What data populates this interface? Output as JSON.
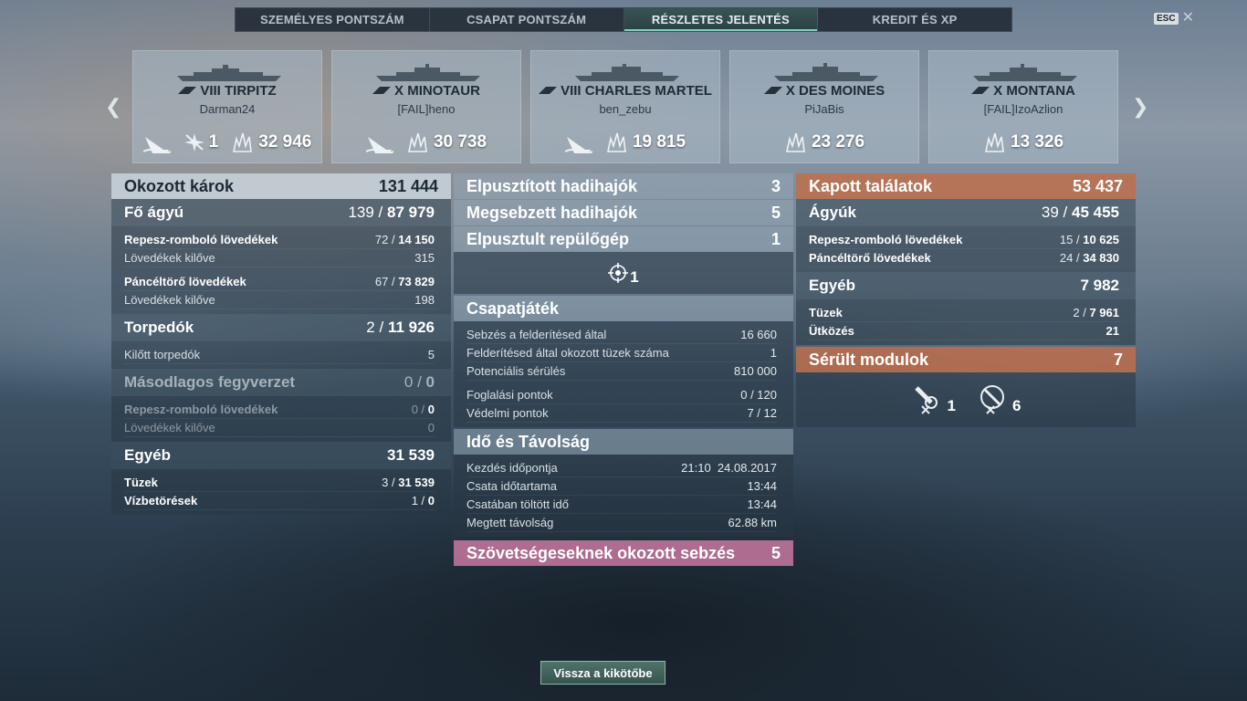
{
  "tabs": [
    "SZEMÉLYES PONTSZÁM",
    "CSAPAT PONTSZÁM",
    "RÉSZLETES JELENTÉS",
    "KREDIT ÉS XP"
  ],
  "active_tab": 2,
  "esc_label": "ESC",
  "ships": [
    {
      "name": "VIII TIRPITZ",
      "player": "Darman24",
      "planes": "1",
      "damage": "32 946"
    },
    {
      "name": "X MINOTAUR",
      "player": "[FAIL]heno",
      "damage": "30 738"
    },
    {
      "name": "VIII CHARLES MARTEL",
      "player": "ben_zebu",
      "damage": "19 815"
    },
    {
      "name": "X DES MOINES",
      "player": "PiJaBis",
      "damage": "23 276"
    },
    {
      "name": "X MONTANA",
      "player": "[FAIL]IzoAzlion",
      "damage": "13 326"
    }
  ],
  "damage_caused": {
    "title": "Okozott károk",
    "total": "131 444",
    "main": {
      "label": "Fő ágyú",
      "hits": "139",
      "dmg": "87 979"
    },
    "he": {
      "label": "Repesz-romboló lövedékek",
      "hits": "72",
      "dmg": "14 150"
    },
    "he_fired": {
      "label": "Lövedékek kilőve",
      "value": "315"
    },
    "ap": {
      "label": "Páncéltörő lövedékek",
      "hits": "67",
      "dmg": "73 829"
    },
    "ap_fired": {
      "label": "Lövedékek kilőve",
      "value": "198"
    },
    "torp": {
      "label": "Torpedók",
      "hits": "2",
      "dmg": "11 926"
    },
    "torp_fired": {
      "label": "Kilőtt torpedók",
      "value": "5"
    },
    "secondary": {
      "label": "Másodlagos fegyverzet",
      "hits": "0",
      "dmg": "0"
    },
    "sec_he": {
      "label": "Repesz-romboló lövedékek",
      "hits": "0",
      "dmg": "0"
    },
    "sec_fired": {
      "label": "Lövedékek kilőve",
      "value": "0"
    },
    "other": {
      "label": "Egyéb",
      "value": "31 539"
    },
    "fires": {
      "label": "Tüzek",
      "hits": "3",
      "dmg": "31 539"
    },
    "floods": {
      "label": "Vízbetörések",
      "hits": "1",
      "dmg": "0"
    }
  },
  "middle": {
    "destroyed": {
      "label": "Elpusztított hadihajók",
      "value": "3"
    },
    "damaged": {
      "label": "Megsebzett hadihajók",
      "value": "5"
    },
    "planes": {
      "label": "Elpusztult repülőgép",
      "value": "1"
    },
    "plane_icon_count": "1",
    "team": {
      "title": "Csapatjáték"
    },
    "spot_dmg": {
      "label": "Sebzés a felderítésed által",
      "value": "16 660"
    },
    "spot_fires": {
      "label": "Felderítésed által okozott tüzek száma",
      "value": "1"
    },
    "potential": {
      "label": "Potenciális sérülés",
      "value": "810 000"
    },
    "cap": {
      "label": "Foglalási pontok",
      "value": "0 / 120"
    },
    "def": {
      "label": "Védelmi pontok",
      "value": "7 / 12"
    },
    "time": {
      "title": "Idő és Távolság"
    },
    "start": {
      "label": "Kezdés időpontja",
      "value": "21:10  24.08.2017"
    },
    "duration": {
      "label": "Csata időtartama",
      "value": "13:44"
    },
    "in_battle": {
      "label": "Csatában töltött idő",
      "value": "13:44"
    },
    "distance": {
      "label": "Megtett távolság",
      "value": "62.88 km"
    },
    "ally_dmg": {
      "label": "Szövetségeseknek okozott sebzés",
      "value": "5"
    }
  },
  "received": {
    "title": "Kapott találatok",
    "total": "53 437",
    "guns": {
      "label": "Ágyúk",
      "hits": "39",
      "dmg": "45 455"
    },
    "he": {
      "label": "Repesz-romboló lövedékek",
      "hits": "15",
      "dmg": "10 625"
    },
    "ap": {
      "label": "Páncéltörő lövedékek",
      "hits": "24",
      "dmg": "34 830"
    },
    "other": {
      "label": "Egyéb",
      "value": "7 982"
    },
    "fires": {
      "label": "Tüzek",
      "hits": "2",
      "dmg": "7 961"
    },
    "ram": {
      "label": "Ütközés",
      "value": "21"
    },
    "modules": {
      "label": "Sérült modulok",
      "value": "7"
    },
    "mod1": "1",
    "mod2": "6"
  },
  "back_button": "Vissza a kikötőbe",
  "colors": {
    "accent": "#7fd0b8",
    "orange": "#be6e4b",
    "pink": "#c878a0"
  }
}
